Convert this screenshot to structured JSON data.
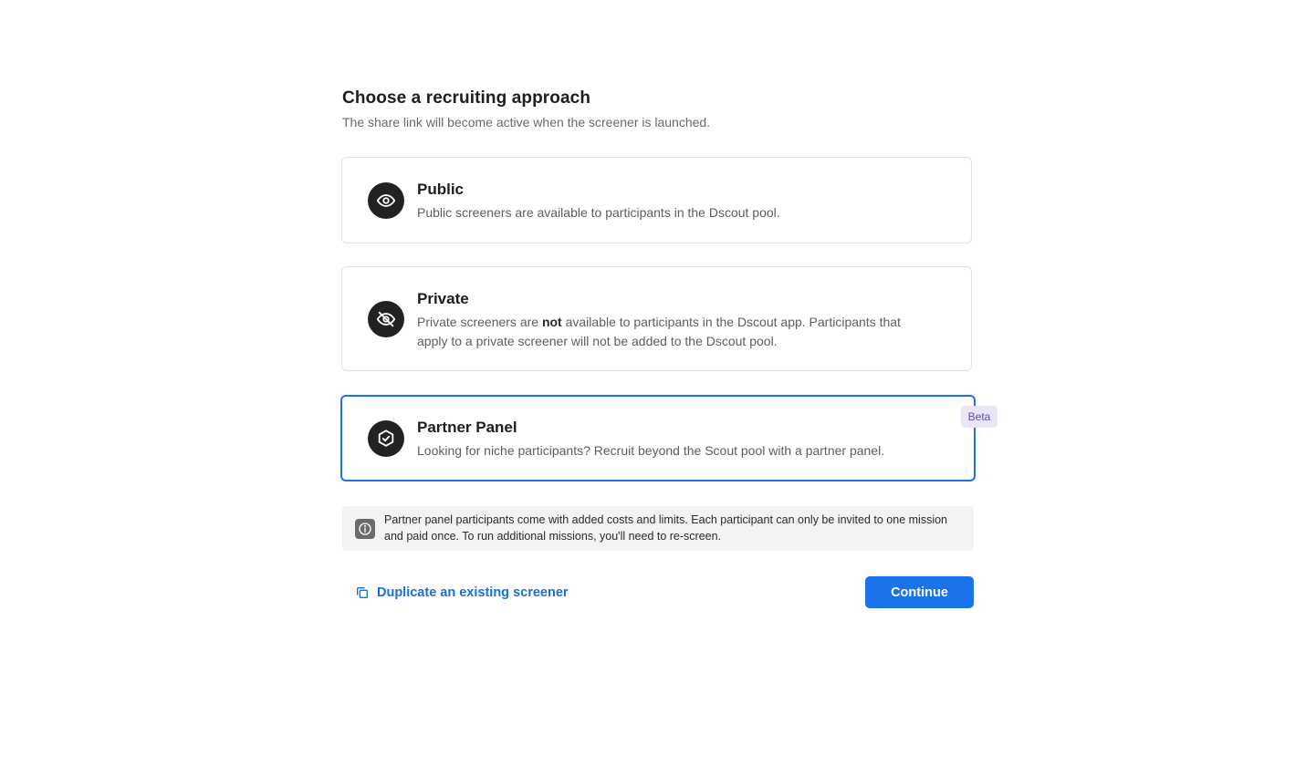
{
  "header": {
    "title": "Choose a recruiting approach",
    "subtitle": "The share link will become active when the screener is launched."
  },
  "options": [
    {
      "title": "Public",
      "description": "Public screeners are available to participants in the Dscout pool.",
      "icon": "eye-icon",
      "selected": false
    },
    {
      "title": "Private",
      "description_before": "Private screeners are ",
      "description_bold": "not",
      "description_after": " available to participants in the Dscout app. Participants that apply to a private screener will not be added to the Dscout pool.",
      "icon": "eye-off-icon",
      "selected": false
    },
    {
      "title": "Partner Panel",
      "description": "Looking for niche participants? Recruit beyond the Scout pool with a partner panel.",
      "icon": "shield-check-icon",
      "badge": "Beta",
      "selected": true
    }
  ],
  "notice": {
    "icon": "info-icon",
    "text": "Partner panel participants come with added costs and limits. Each participant can only be invited to one mission and paid once. To run additional missions, you'll need to re-screen."
  },
  "footer": {
    "duplicate_label": "Duplicate an existing screener",
    "duplicate_icon": "copy-icon",
    "continue_label": "Continue"
  },
  "colors": {
    "accent": "#1a73e8",
    "badge_bg": "#e8e6f7",
    "badge_text": "#5a4fb2"
  }
}
